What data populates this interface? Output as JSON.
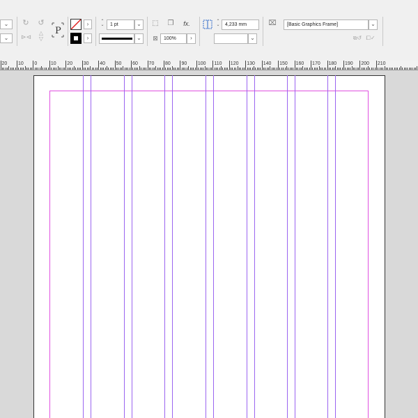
{
  "toolbar": {
    "stroke_weight": "1 pt",
    "opacity": "100%",
    "column_gutter": "4,233 mm",
    "object_style": "[Basic Graphics Frame]",
    "text_frame_icon_glyph": "P"
  },
  "ruler": {
    "labels": [
      "20",
      "10",
      "0",
      "10",
      "20",
      "30",
      "40",
      "50",
      "60",
      "70",
      "80",
      "90",
      "100",
      "110",
      "120",
      "130",
      "140",
      "150",
      "160",
      "170",
      "180",
      "190",
      "200",
      "210"
    ]
  },
  "colors": {
    "margin_guide": "#e050e0",
    "column_guide": "#9a64f0",
    "pasteboard": "#d9d9d9"
  },
  "icons": {
    "rotate_cw": "rotate-clockwise-icon",
    "rotate_ccw": "rotate-counterclockwise-icon",
    "flip_h": "flip-horizontal-icon",
    "flip_v": "flip-vertical-icon",
    "text_frame": "text-frame-p-icon",
    "fill_none": "fill-none-icon",
    "stroke_black": "stroke-swatch-icon",
    "frame_corner": "frame-corner-icon",
    "drop_shadow": "drop-shadow-icon",
    "effects": "fx-icon",
    "opacity": "opacity-icon",
    "column_grid": "column-grid-icon",
    "object_style": "object-style-icon",
    "clear_overrides": "clear-overrides-icon"
  }
}
